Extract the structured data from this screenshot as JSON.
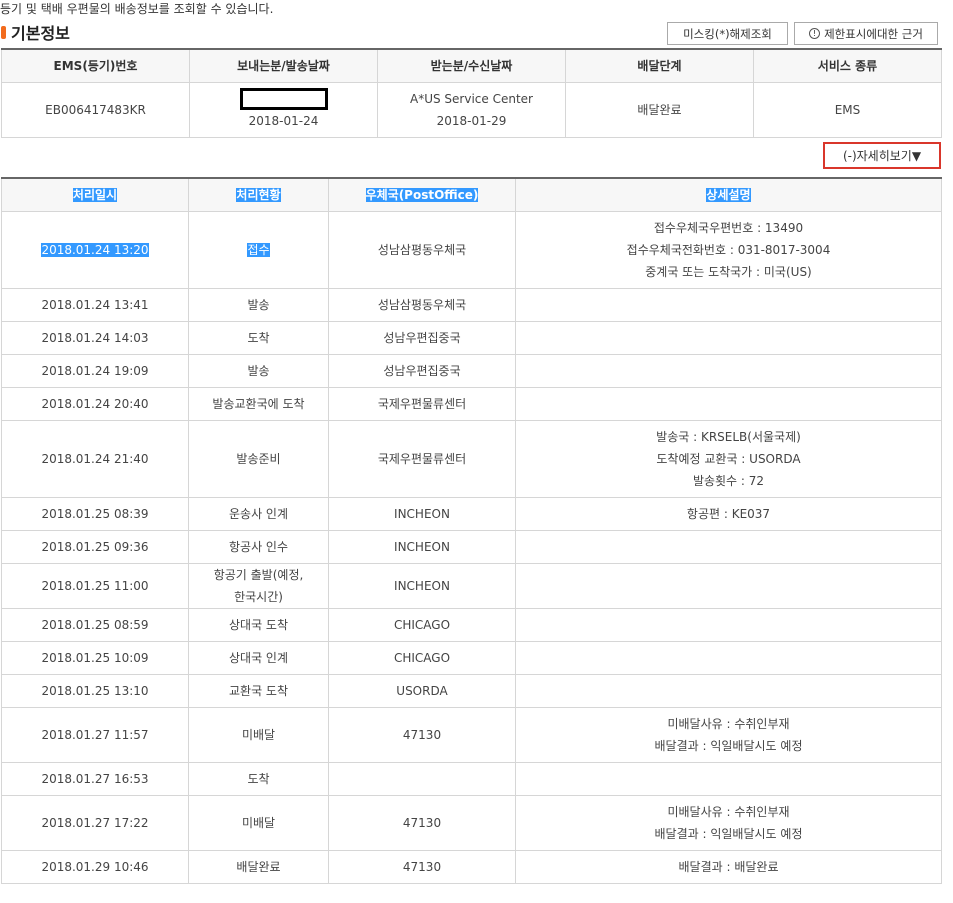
{
  "intro": "등기 및 택배 우편물의 배송정보를 조회할 수 있습니다.",
  "section_title": "기본정보",
  "buttons": {
    "unmask": "미스킹(*)해제조회",
    "basis_icon": "info-circle-icon",
    "basis": "제한표시에대한 근거",
    "detail_toggle": "(-)자세히보기▼"
  },
  "basic_info": {
    "headers": [
      "EMS(등기)번호",
      "보내는분/발송날짜",
      "받는분/수신날짜",
      "배달단계",
      "서비스 종류"
    ],
    "tracking_number": "EB006417483KR",
    "sender_date": "2018-01-24",
    "receiver_name": "A*US Service Center",
    "receiver_date": "2018-01-29",
    "delivery_stage": "배달완료",
    "service_type": "EMS"
  },
  "detail": {
    "headers": [
      "처리일시",
      "처리현황",
      "우체국(PostOffice)",
      "상세설명"
    ],
    "rows": [
      {
        "datetime": "2018.01.24 13:20",
        "status": "접수",
        "office": "성남삼평동우체국",
        "details": [
          "접수우체국우편번호 : 13490",
          "접수우체국전화번호 : 031-8017-3004",
          "중계국 또는 도착국가 : 미국(US)"
        ]
      },
      {
        "datetime": "2018.01.24 13:41",
        "status": "발송",
        "office": "성남삼평동우체국",
        "details": []
      },
      {
        "datetime": "2018.01.24 14:03",
        "status": "도착",
        "office": "성남우편집중국",
        "details": []
      },
      {
        "datetime": "2018.01.24 19:09",
        "status": "발송",
        "office": "성남우편집중국",
        "details": []
      },
      {
        "datetime": "2018.01.24 20:40",
        "status": "발송교환국에 도착",
        "office": "국제우편물류센터",
        "details": []
      },
      {
        "datetime": "2018.01.24 21:40",
        "status": "발송준비",
        "office": "국제우편물류센터",
        "details": [
          "발송국 : KRSELB(서울국제)",
          "도착예정 교환국 : USORDA",
          "발송횟수 : 72"
        ]
      },
      {
        "datetime": "2018.01.25 08:39",
        "status": "운송사 인계",
        "office": "INCHEON",
        "details": [
          "항공편 : KE037"
        ]
      },
      {
        "datetime": "2018.01.25 09:36",
        "status": "항공사 인수",
        "office": "INCHEON",
        "details": []
      },
      {
        "datetime": "2018.01.25 11:00",
        "status_lines": [
          "항공기 출발(예정,",
          "한국시간)"
        ],
        "office": "INCHEON",
        "details": []
      },
      {
        "datetime": "2018.01.25 08:59",
        "status": "상대국 도착",
        "office": "CHICAGO",
        "details": []
      },
      {
        "datetime": "2018.01.25 10:09",
        "status": "상대국 인계",
        "office": "CHICAGO",
        "details": []
      },
      {
        "datetime": "2018.01.25 13:10",
        "status": "교환국 도착",
        "office": "USORDA",
        "details": []
      },
      {
        "datetime": "2018.01.27 11:57",
        "status": "미배달",
        "office": "47130",
        "details": [
          "미배달사유 : 수취인부재",
          "배달결과 : 익일배달시도 예정"
        ]
      },
      {
        "datetime": "2018.01.27 16:53",
        "status": "도착",
        "office": "",
        "details": []
      },
      {
        "datetime": "2018.01.27 17:22",
        "status": "미배달",
        "office": "47130",
        "details": [
          "미배달사유 : 수취인부재",
          "배달결과 : 익일배달시도 예정"
        ]
      },
      {
        "datetime": "2018.01.29 10:46",
        "status": "배달완료",
        "office": "47130",
        "details": [
          "배달결과 : 배달완료"
        ]
      }
    ]
  }
}
